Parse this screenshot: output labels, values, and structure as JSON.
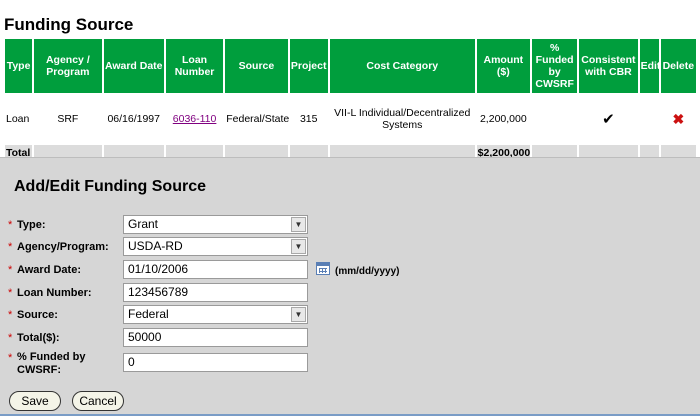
{
  "page_title": "Funding Source",
  "table": {
    "headers": [
      "Type",
      "Agency / Program",
      "Award Date",
      "Loan Number",
      "Source",
      "Project",
      "Cost Category",
      "Amount ($)",
      "% Funded by CWSRF",
      "Consistent with CBR",
      "Edit",
      "Delete"
    ],
    "row": {
      "type": "Loan",
      "agency": "SRF",
      "award_date": "06/16/1997",
      "loan_number": "6036-110",
      "source": "Federal/State",
      "project": "315",
      "cost_category": "VII-L Individual/Decentralized Systems",
      "amount": "2,200,000",
      "percent_funded": "",
      "consistent_cbr": "✔",
      "delete_symbol": "✖"
    },
    "total": {
      "label": "Total",
      "amount": "$2,200,000"
    }
  },
  "form": {
    "title": "Add/Edit Funding Source",
    "required_mark": "*",
    "type": {
      "label": "Type:",
      "value": "Grant"
    },
    "agency": {
      "label": "Agency/Program:",
      "value": "USDA-RD"
    },
    "award_date": {
      "label": "Award Date:",
      "value": "01/10/2006",
      "hint": "(mm/dd/yyyy)"
    },
    "loan_number": {
      "label": "Loan Number:",
      "value": "123456789"
    },
    "source": {
      "label": "Source:",
      "value": "Federal"
    },
    "total": {
      "label": "Total($):",
      "value": "50000"
    },
    "percent": {
      "label_line1": "% Funded by",
      "label_line2": "CWSRF:",
      "value": "0"
    },
    "save_label": "Save",
    "cancel_label": "Cancel"
  },
  "icons": {
    "dropdown": "chevron-down-icon",
    "calendar": "calendar-icon",
    "check": "checkmark-icon",
    "delete": "delete-x-icon"
  },
  "colors": {
    "header_green": "#009e3d",
    "total_gray": "#dcdcdc",
    "panel_gray": "#d6d6d6",
    "required_red": "#cc0000",
    "link_purple": "#800080",
    "delete_red": "#cc1111"
  }
}
